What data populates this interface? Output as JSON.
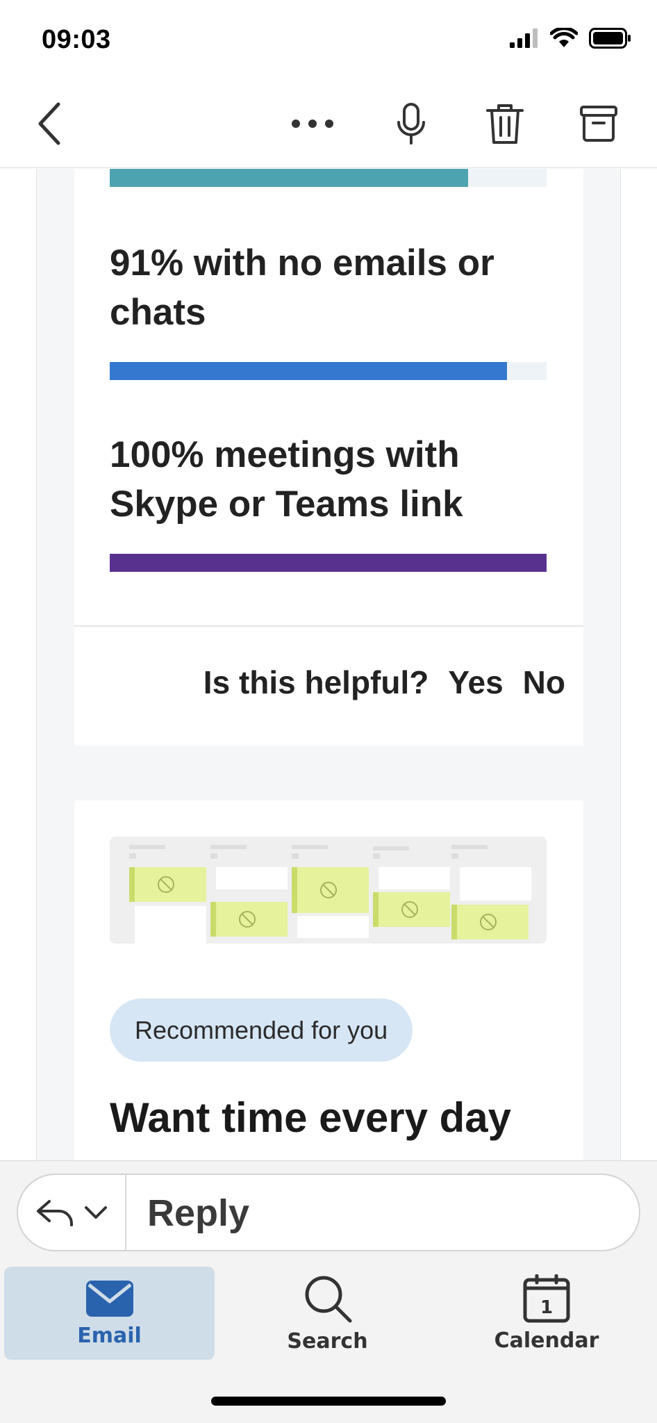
{
  "status": {
    "time": "09:03"
  },
  "stats": [
    {
      "label": "",
      "percent": 82,
      "color": "#4da4b0"
    },
    {
      "label": "91% with no emails or chats",
      "percent": 91,
      "color": "#3478cf"
    },
    {
      "label": "100% meetings with Skype or Teams link",
      "percent": 100,
      "color": "#58318f"
    }
  ],
  "feedback": {
    "question": "Is this helpful?",
    "yes": "Yes",
    "no": "No"
  },
  "recommendation": {
    "badge": "Recommended for you",
    "title": "Want time every day"
  },
  "reply": {
    "label": "Reply"
  },
  "tabs": [
    {
      "label": "Email",
      "icon": "envelope-icon",
      "active": true
    },
    {
      "label": "Search",
      "icon": "search-icon",
      "active": false
    },
    {
      "label": "Calendar",
      "icon": "calendar-icon",
      "active": false,
      "badge": "1"
    }
  ],
  "colors": {
    "accent": "#2a63ad",
    "tab_active_bg": "#cfdde9",
    "illustration_block": "#e6f29c"
  }
}
